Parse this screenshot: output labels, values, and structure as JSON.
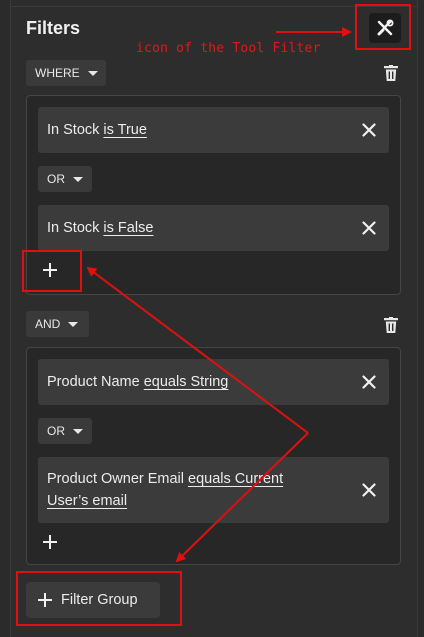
{
  "panel": {
    "title": "Filters"
  },
  "annotation": {
    "tool_label": "icon of the Tool Filter",
    "color": "#e01010"
  },
  "groups": [
    {
      "connector": "WHERE",
      "conditions": [
        {
          "field": "In Stock",
          "operator": "is True"
        },
        {
          "field": "In Stock",
          "operator": "is False"
        }
      ],
      "join": "OR"
    },
    {
      "connector": "AND",
      "conditions": [
        {
          "field": "Product Name",
          "operator": "equals String"
        },
        {
          "field": "Product Owner Email",
          "operator": "equals Current",
          "operator_line2": "User’s email"
        }
      ],
      "join": "OR"
    }
  ],
  "footer": {
    "add_group_label": "Filter Group"
  },
  "icons": {
    "tool": "tools-icon",
    "delete": "trash-icon",
    "remove": "close-icon",
    "add": "plus-icon",
    "dropdown": "chevron-down-icon"
  }
}
